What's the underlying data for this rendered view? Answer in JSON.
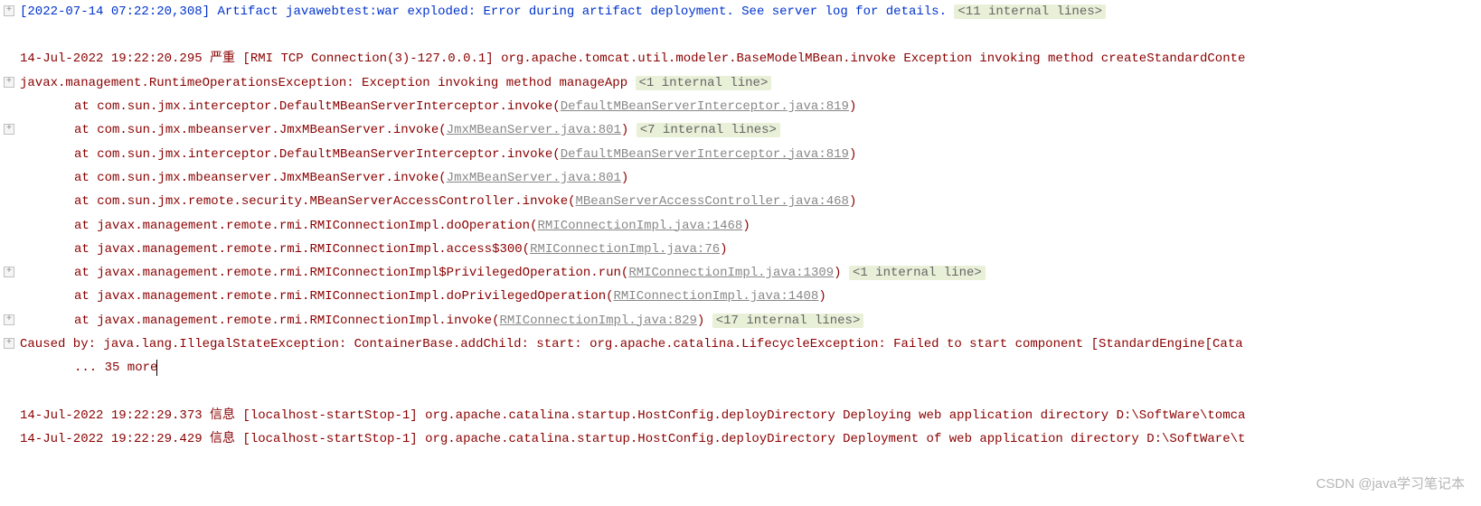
{
  "line1": {
    "timestamp": "[2022-07-14 07:22:20,308]",
    "message": " Artifact javawebtest:war exploded: Error during artifact deployment. See server log for details. ",
    "fold": "<11 internal lines>"
  },
  "line2": "14-Jul-2022 19:22:20.295 严重 [RMI TCP Connection(3)-127.0.0.1] org.apache.tomcat.util.modeler.BaseModelMBean.invoke Exception invoking method createStandardConte",
  "line3": {
    "prefix": " javax.management.RuntimeOperationsException: Exception invoking method manageApp ",
    "fold": "<1 internal line>"
  },
  "line4": {
    "at": "at com.sun.jmx.interceptor.DefaultMBeanServerInterceptor.invoke(",
    "link": "DefaultMBeanServerInterceptor.java:819",
    "close": ")"
  },
  "line5": {
    "at": "at com.sun.jmx.mbeanserver.JmxMBeanServer.invoke(",
    "link": "JmxMBeanServer.java:801",
    "close": ") ",
    "fold": "<7 internal lines>"
  },
  "line6": {
    "at": "at com.sun.jmx.interceptor.DefaultMBeanServerInterceptor.invoke(",
    "link": "DefaultMBeanServerInterceptor.java:819",
    "close": ")"
  },
  "line7": {
    "at": "at com.sun.jmx.mbeanserver.JmxMBeanServer.invoke(",
    "link": "JmxMBeanServer.java:801",
    "close": ")"
  },
  "line8": {
    "at": "at com.sun.jmx.remote.security.MBeanServerAccessController.invoke(",
    "link": "MBeanServerAccessController.java:468",
    "close": ")"
  },
  "line9": {
    "at": "at javax.management.remote.rmi.RMIConnectionImpl.doOperation(",
    "link": "RMIConnectionImpl.java:1468",
    "close": ")"
  },
  "line10": {
    "at": "at javax.management.remote.rmi.RMIConnectionImpl.access$300(",
    "link": "RMIConnectionImpl.java:76",
    "close": ")"
  },
  "line11": {
    "at": "at javax.management.remote.rmi.RMIConnectionImpl$PrivilegedOperation.run(",
    "link": "RMIConnectionImpl.java:1309",
    "close": ") ",
    "fold": "<1 internal line>"
  },
  "line12": {
    "at": "at javax.management.remote.rmi.RMIConnectionImpl.doPrivilegedOperation(",
    "link": "RMIConnectionImpl.java:1408",
    "close": ")"
  },
  "line13": {
    "at": "at javax.management.remote.rmi.RMIConnectionImpl.invoke(",
    "link": "RMIConnectionImpl.java:829",
    "close": ") ",
    "fold": "<17 internal lines>"
  },
  "line14": "Caused by: java.lang.IllegalStateException: ContainerBase.addChild: start: org.apache.catalina.LifecycleException: Failed to start component [StandardEngine[Cata",
  "line15": "... 35 more",
  "line16": "14-Jul-2022 19:22:29.373 信息 [localhost-startStop-1] org.apache.catalina.startup.HostConfig.deployDirectory Deploying web application directory D:\\SoftWare\\tomca",
  "line17": "14-Jul-2022 19:22:29.429 信息 [localhost-startStop-1] org.apache.catalina.startup.HostConfig.deployDirectory Deployment of web application directory D:\\SoftWare\\t",
  "watermark": "CSDN @java学习笔记本"
}
